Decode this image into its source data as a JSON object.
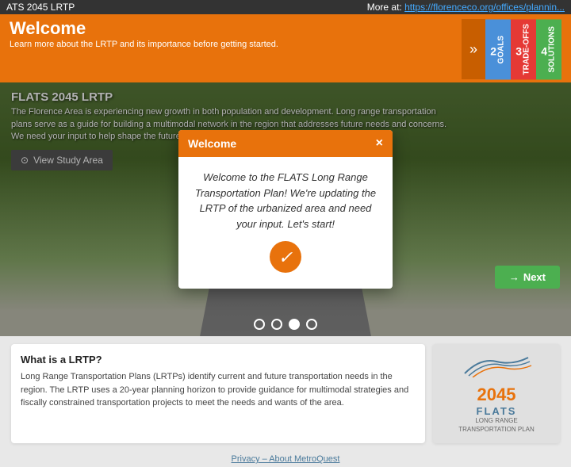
{
  "topbar": {
    "title": "ATS 2045 LRTP",
    "more_at": "More at:",
    "link_text": "https://florenceco.org/offices/plannin...",
    "link_url": "#"
  },
  "header": {
    "title": "Welcome",
    "subtitle": "Learn more about the LRTP and its importance before getting started.",
    "arrow_label": "»"
  },
  "tabs": [
    {
      "num": "2",
      "label": "GOALS",
      "color": "#4a90d9"
    },
    {
      "num": "3",
      "label": "TRADE-OFFS",
      "color": "#e53935"
    },
    {
      "num": "4",
      "label": "SOLUTIONS",
      "color": "#4caf50"
    }
  ],
  "hero": {
    "section_title": "FLATS 2045 LRTP",
    "section_desc": "The Florence Area is experiencing new growth in both population and development. Long range transportation plans serve as a guide for building a multimodal network in the region that addresses future needs and concerns. We need your input to help shape the future of transportation in the area!",
    "view_study_btn": "View Study Area"
  },
  "carousel": {
    "dots": [
      false,
      false,
      true,
      false
    ]
  },
  "modal": {
    "title": "Welcome",
    "body": "Welcome to the FLATS Long Range Transportation Plan! We're updating the LRTP of the urbanized area and need your input. Let's start!",
    "close_label": "×",
    "check_icon": "✓"
  },
  "next_btn": {
    "label": "Next",
    "arrow": "→"
  },
  "bottom": {
    "card1": {
      "title": "What is a LRTP?",
      "desc": "Long Range Transportation Plans (LRTPs) identify current and future transportation needs in the region. The LRTP uses a 20-year planning horizon to provide guidance for multimodal strategies and fiscally constrained transportation projects to meet the needs and wants of the area."
    },
    "logo": {
      "year": "2045",
      "brand": "FLATS",
      "sub": "LONG RANGE TRANSPORTATION PLAN"
    }
  },
  "footer": {
    "text": "Privacy – About MetroQuest"
  }
}
